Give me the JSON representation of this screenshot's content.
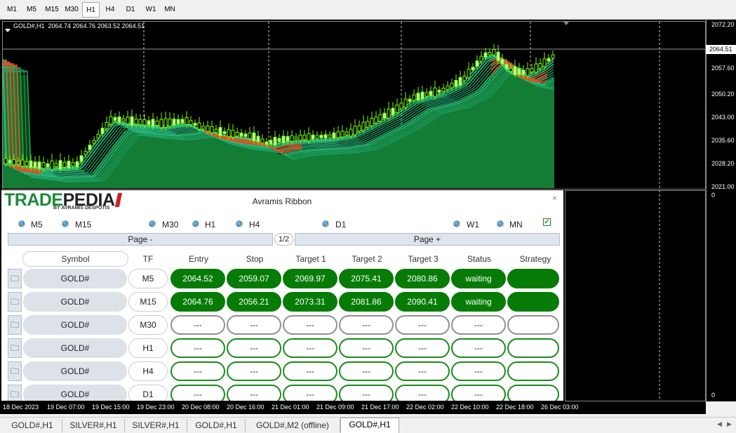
{
  "timeframe_bar": {
    "buttons": [
      "M1",
      "M5",
      "M15",
      "M30",
      "H1",
      "H4",
      "D1",
      "W1",
      "MN"
    ],
    "active": "H1"
  },
  "chart": {
    "info_line": "GOLD#,H1  2064.74 2064.76 2063.52 2064.51",
    "current_price": "2064.51",
    "price_labels": [
      "2072.20",
      "2064.51",
      "2057.60",
      "2050.20",
      "2043.00",
      "2035.60",
      "2028.20",
      "2021.00"
    ],
    "sub_labels": [
      "0",
      "0"
    ],
    "time_labels": [
      "18 Dec 2023",
      "19 Dec 07:00",
      "19 Dec 15:00",
      "19 Dec 23:00",
      "20 Dec 08:00",
      "20 Dec 16:00",
      "21 Dec 01:00",
      "21 Dec 09:00",
      "21 Dec 17:00",
      "22 Dec 02:00",
      "22 Dec 10:00",
      "22 Dec 18:00",
      "26 Dec 03:00"
    ]
  },
  "panel": {
    "logo_main_1": "TRADE",
    "logo_main_2": "PEDIA",
    "logo_sub": "BY AVRAMIS DESPOTIS",
    "title": "Avramis Ribbon",
    "close": "×",
    "timeframes": [
      "M5",
      "M15",
      "M30",
      "H1",
      "H4",
      "D1",
      "W1",
      "MN"
    ],
    "checkbox": "✓",
    "page_prev": "Page -",
    "page_indicator": "1/2",
    "page_next": "Page +",
    "headers": {
      "symbol": "Symbol",
      "tf": "TF",
      "entry": "Entry",
      "stop": "Stop",
      "target1": "Target 1",
      "target2": "Target 2",
      "target3": "Target 3",
      "status": "Status",
      "strategy": "Strategy"
    },
    "rows": [
      {
        "symbol": "GOLD#",
        "tf": "M5",
        "entry": "2064.52",
        "stop": "2059.07",
        "target1": "2069.97",
        "target2": "2075.41",
        "target3": "2080.86",
        "status": "waiting",
        "strategy": ""
      },
      {
        "symbol": "GOLD#",
        "tf": "M15",
        "entry": "2064.76",
        "stop": "2056.21",
        "target1": "2073.31",
        "target2": "2081.86",
        "target3": "2090.41",
        "status": "waiting",
        "strategy": ""
      },
      {
        "symbol": "GOLD#",
        "tf": "M30",
        "entry": "---",
        "stop": "---",
        "target1": "---",
        "target2": "---",
        "target3": "---",
        "status": "---",
        "strategy": ""
      },
      {
        "symbol": "GOLD#",
        "tf": "H1",
        "entry": "---",
        "stop": "---",
        "target1": "---",
        "target2": "---",
        "target3": "---",
        "status": "---",
        "strategy": ""
      },
      {
        "symbol": "GOLD#",
        "tf": "H4",
        "entry": "---",
        "stop": "---",
        "target1": "---",
        "target2": "---",
        "target3": "---",
        "status": "---",
        "strategy": ""
      },
      {
        "symbol": "GOLD#",
        "tf": "D1",
        "entry": "---",
        "stop": "---",
        "target1": "---",
        "target2": "---",
        "target3": "---",
        "status": "---",
        "strategy": ""
      }
    ],
    "folder_icon": "🗀"
  },
  "tabs": [
    "GOLD#,H1",
    "SILVER#,H1",
    "SILVER#,H1",
    "GOLD#,H1",
    "GOLD#,M2 (offline)",
    "GOLD#,H1"
  ],
  "active_tab": 5,
  "colors": {
    "green": "#067c06",
    "ribbon_green": "#2ecc8a",
    "ribbon_red": "#e05020"
  }
}
